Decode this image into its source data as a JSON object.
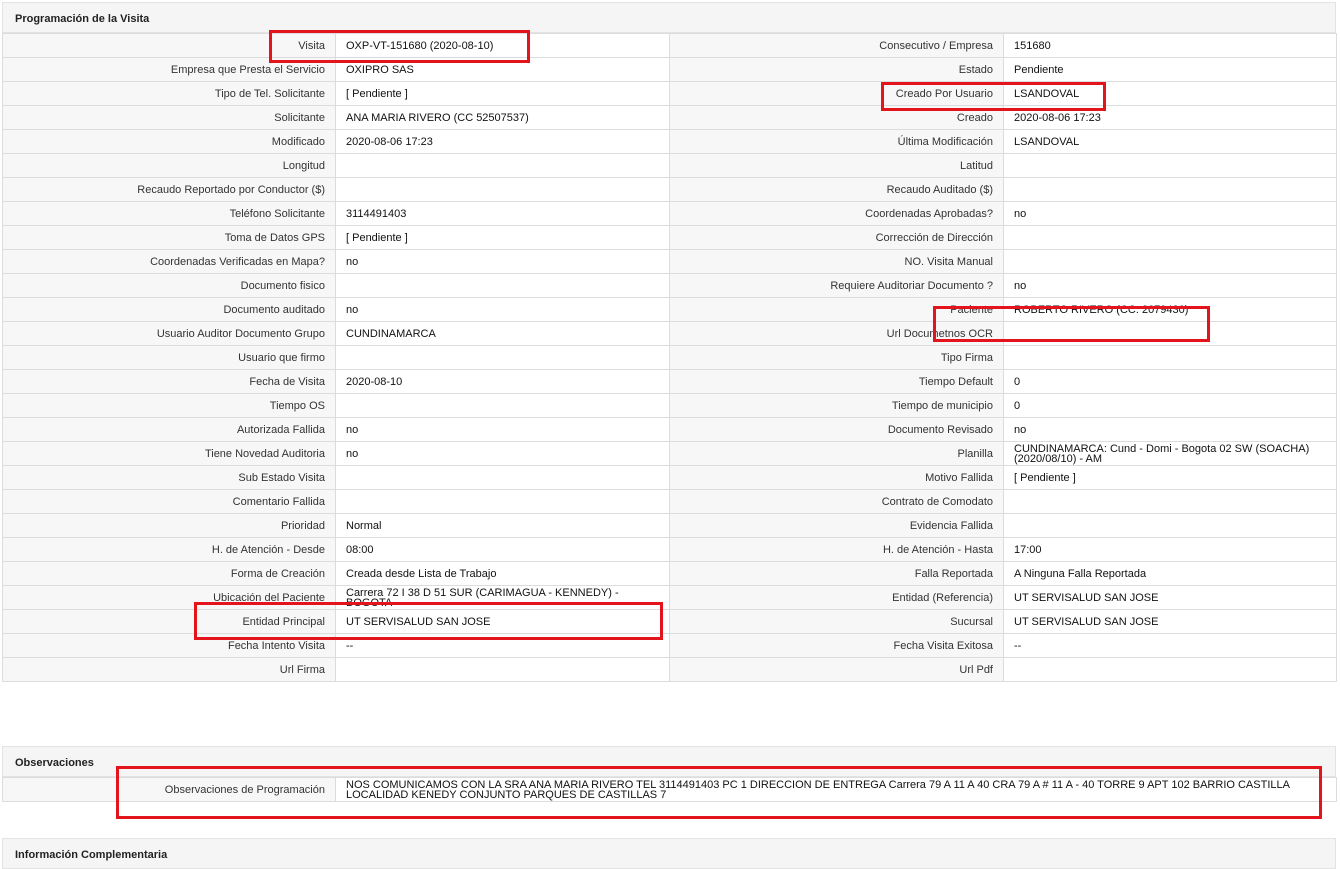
{
  "section_visit": {
    "title": "Programación de la Visita",
    "rows": [
      {
        "l1": "Visita",
        "v1": "OXP-VT-151680 (2020-08-10)",
        "l2": "Consecutivo / Empresa",
        "v2": "151680"
      },
      {
        "l1": "Empresa que Presta el Servicio",
        "v1": "OXIPRO SAS",
        "l2": "Estado",
        "v2": "Pendiente"
      },
      {
        "l1": "Tipo de Tel. Solicitante",
        "v1": "[ Pendiente ]",
        "l2": "Creado Por Usuario",
        "v2": "LSANDOVAL"
      },
      {
        "l1": "Solicitante",
        "v1": "ANA MARIA RIVERO (CC 52507537)",
        "l2": "Creado",
        "v2": "2020-08-06 17:23"
      },
      {
        "l1": "Modificado",
        "v1": "2020-08-06 17:23",
        "l2": "Última Modificación",
        "v2": " LSANDOVAL"
      },
      {
        "l1": "Longitud",
        "v1": "",
        "l2": "Latitud",
        "v2": ""
      },
      {
        "l1": "Recaudo Reportado por Conductor ($)",
        "v1": "",
        "l2": "Recaudo Auditado ($)",
        "v2": ""
      },
      {
        "l1": "Teléfono Solicitante",
        "v1": "3114491403",
        "l2": "Coordenadas Aprobadas?",
        "v2": " no"
      },
      {
        "l1": "Toma de Datos GPS",
        "v1": "[ Pendiente ]",
        "l2": "Corrección de Dirección",
        "v2": ""
      },
      {
        "l1": "Coordenadas Verificadas en Mapa?",
        "v1": " no",
        "l2": "NO. Visita Manual",
        "v2": ""
      },
      {
        "l1": "Documento fisico",
        "v1": "",
        "l2": "Requiere Auditoriar Documento ?",
        "v2": " no"
      },
      {
        "l1": "Documento auditado",
        "v1": " no",
        "l2": "Paciente",
        "v2": "ROBERTO RIVERO (CC: 2079430)"
      },
      {
        "l1": "Usuario Auditor Documento Grupo",
        "v1": "CUNDINAMARCA",
        "l2": "Url Documetnos OCR",
        "v2": ""
      },
      {
        "l1": "Usuario que firmo",
        "v1": "",
        "l2": "Tipo Firma",
        "v2": ""
      },
      {
        "l1": "Fecha de Visita",
        "v1": " 2020-08-10",
        "l2": "Tiempo Default",
        "v2": " 0"
      },
      {
        "l1": "Tiempo OS",
        "v1": "",
        "l2": "Tiempo de municipio",
        "v2": " 0"
      },
      {
        "l1": "Autorizada Fallida",
        "v1": " no",
        "l2": "Documento Revisado",
        "v2": " no"
      },
      {
        "l1": "Tiene Novedad Auditoria",
        "v1": " no",
        "l2": "Planilla",
        "v2": "CUNDINAMARCA: Cund - Domi - Bogota 02 SW (SOACHA) (2020/08/10) - AM"
      },
      {
        "l1": "Sub Estado Visita",
        "v1": "",
        "l2": "Motivo Fallida",
        "v2": "[ Pendiente ]"
      },
      {
        "l1": "Comentario Fallida",
        "v1": "",
        "l2": "Contrato de Comodato",
        "v2": ""
      },
      {
        "l1": "Prioridad",
        "v1": "Normal",
        "l2": "Evidencia Fallida",
        "v2": ""
      },
      {
        "l1": "H. de Atención - Desde",
        "v1": "08:00",
        "l2": "H. de Atención - Hasta",
        "v2": " 17:00"
      },
      {
        "l1": "Forma de Creación",
        "v1": "Creada desde Lista de Trabajo",
        "l2": "Falla Reportada",
        "v2": "A Ninguna Falla Reportada"
      },
      {
        "l1": "Ubicación del Paciente",
        "v1": "Carrera 72 I 38 D 51 SUR (CARIMAGUA - KENNEDY) - BOGOTA",
        "l2": "Entidad (Referencia)",
        "v2": "UT SERVISALUD SAN JOSE"
      },
      {
        "l1": "Entidad Principal",
        "v1": "UT SERVISALUD SAN JOSE",
        "l2": "Sucursal",
        "v2": "UT SERVISALUD SAN JOSE"
      },
      {
        "l1": "Fecha Intento Visita",
        "v1": " --",
        "l2": "Fecha Visita Exitosa",
        "v2": " --"
      },
      {
        "l1": "Url Firma",
        "v1": "",
        "l2": "Url Pdf",
        "v2": ""
      }
    ]
  },
  "section_obs": {
    "title": "Observaciones",
    "label": "Observaciones de Programación",
    "value": " NOS COMUNICAMOS CON LA SRA ANA MARIA RIVERO TEL 3114491403 PC 1 DIRECCION DE ENTREGA Carrera 79 A 11 A 40 CRA 79 A # 11 A - 40 TORRE 9 APT 102 BARRIO CASTILLA LOCALIDAD KENEDY CONJUNTO PARQUES DE CASTILLAS 7"
  },
  "section_info": {
    "title": "Información Complementaria"
  },
  "highlight_color": "#e3141c"
}
